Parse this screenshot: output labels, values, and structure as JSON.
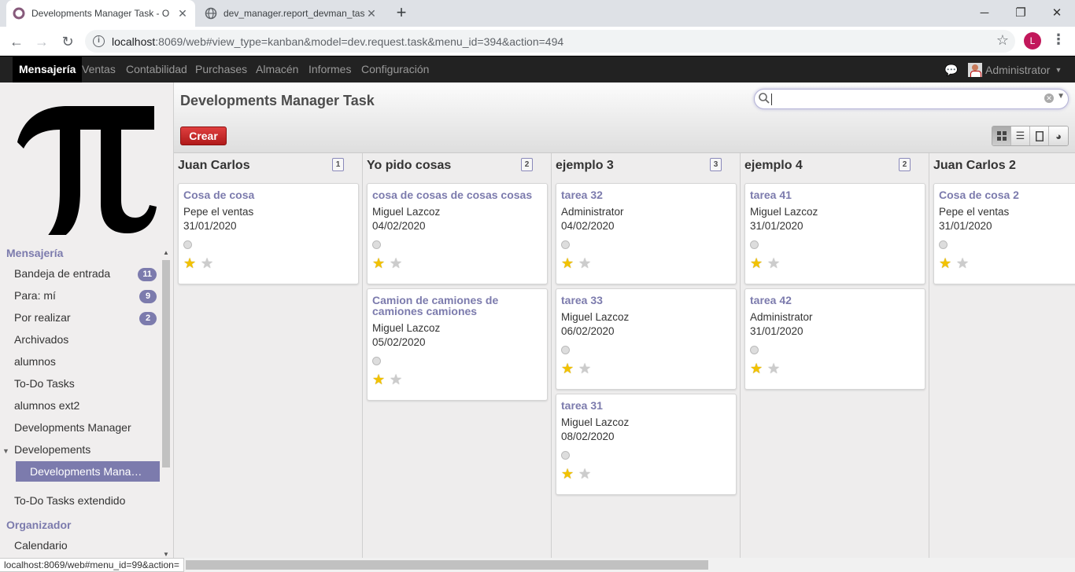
{
  "browser": {
    "tabs": [
      {
        "title": "Developments Manager Task - O",
        "active": true
      },
      {
        "title": "dev_manager.report_devman_tas",
        "active": false
      }
    ],
    "url_host": "localhost",
    "url_rest": ":8069/web#view_type=kanban&model=dev.request.task&menu_id=394&action=494",
    "profile_initial": "L"
  },
  "topnav": {
    "menus": [
      "Mensajería",
      "Ventas",
      "Contabilidad",
      "Purchases",
      "Almacén",
      "Informes",
      "Configuración"
    ],
    "active_index": 0,
    "user": "Administrator"
  },
  "sidebar": {
    "sections": [
      {
        "title": "Mensajería"
      },
      {
        "title": "Organizador"
      }
    ],
    "items": [
      {
        "label": "Bandeja de entrada",
        "badge": "11"
      },
      {
        "label": "Para: mí",
        "badge": "9"
      },
      {
        "label": "Por realizar",
        "badge": "2"
      },
      {
        "label": "Archivados"
      },
      {
        "label": "alumnos"
      },
      {
        "label": "To-Do Tasks"
      },
      {
        "label": "alumnos ext2"
      },
      {
        "label": "Developments Manager"
      },
      {
        "label": "Developements"
      },
      {
        "label": "Developments Mana…"
      },
      {
        "label": "To-Do Tasks extendido"
      },
      {
        "label": "Calendario"
      }
    ]
  },
  "main": {
    "title": "Developments Manager Task",
    "create_label": "Crear",
    "search_placeholder": "",
    "columns": [
      {
        "title": "Juan Carlos",
        "count": "1",
        "cards": [
          {
            "title": "Cosa de cosa",
            "user": "Pepe el ventas",
            "date": "31/01/2020",
            "stars": 1
          }
        ]
      },
      {
        "title": "Yo pido cosas",
        "count": "2",
        "cards": [
          {
            "title": "cosa de cosas de cosas cosas",
            "user": "Miguel Lazcoz",
            "date": "04/02/2020",
            "stars": 1
          },
          {
            "title": "Camion de camiones de camiones camiones",
            "user": "Miguel Lazcoz",
            "date": "05/02/2020",
            "stars": 1
          }
        ]
      },
      {
        "title": "ejemplo 3",
        "count": "3",
        "cards": [
          {
            "title": "tarea 32",
            "user": "Administrator",
            "date": "04/02/2020",
            "stars": 1
          },
          {
            "title": "tarea 33",
            "user": "Miguel Lazcoz",
            "date": "06/02/2020",
            "stars": 1
          },
          {
            "title": "tarea 31",
            "user": "Miguel Lazcoz",
            "date": "08/02/2020",
            "stars": 1
          }
        ]
      },
      {
        "title": "ejemplo 4",
        "count": "2",
        "cards": [
          {
            "title": "tarea 41",
            "user": "Miguel Lazcoz",
            "date": "31/01/2020",
            "stars": 1
          },
          {
            "title": "tarea 42",
            "user": "Administrator",
            "date": "31/01/2020",
            "stars": 1
          }
        ]
      },
      {
        "title": "Juan Carlos 2",
        "count": "",
        "cards": [
          {
            "title": "Cosa de cosa 2",
            "user": "Pepe el ventas",
            "date": "31/01/2020",
            "stars": 1
          }
        ]
      }
    ]
  },
  "status_bar": "localhost:8069/web#menu_id=99&action=",
  "colors": {
    "accent": "#7c7bad",
    "create_button": "#c32727",
    "topbar": "#222222"
  }
}
